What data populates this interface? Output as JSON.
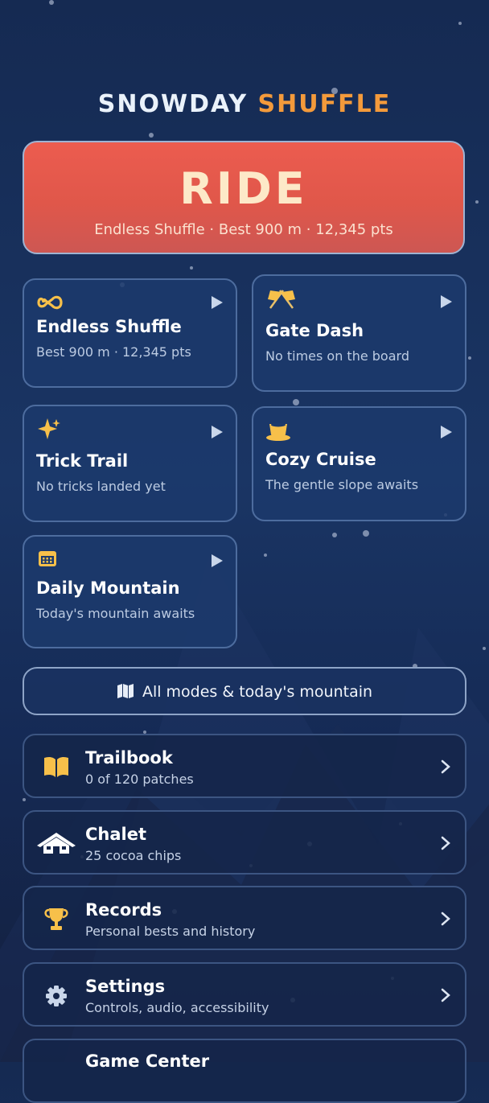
{
  "app": {
    "title_part1": "SNOWDAY",
    "title_part2": "SHUFFLE"
  },
  "ride": {
    "label": "RIDE",
    "subtitle": "Endless Shuffle · Best 900 m · 12,345 pts"
  },
  "modes": [
    {
      "title": "Endless Shuffle",
      "subtitle": "Best 900 m · 12,345 pts",
      "icon": "infinity-icon"
    },
    {
      "title": "Gate Dash",
      "subtitle": "No times on the board",
      "icon": "crossed-flags-icon"
    },
    {
      "title": "Trick Trail",
      "subtitle": "No tricks landed yet",
      "icon": "sparkles-icon"
    },
    {
      "title": "Cozy Cruise",
      "subtitle": "The gentle slope awaits",
      "icon": "cocoa-cup-icon"
    },
    {
      "title": "Daily Mountain",
      "subtitle": "Today's mountain awaits",
      "icon": "calendar-icon"
    }
  ],
  "all_modes": {
    "label": "All modes & today's mountain",
    "icon": "map-icon"
  },
  "menu": [
    {
      "title": "Trailbook",
      "subtitle": "0 of 120 patches",
      "icon": "book-icon"
    },
    {
      "title": "Chalet",
      "subtitle": "25 cocoa chips",
      "icon": "chalet-icon"
    },
    {
      "title": "Records",
      "subtitle": "Personal bests and history",
      "icon": "trophy-icon"
    },
    {
      "title": "Settings",
      "subtitle": "Controls, audio, accessibility",
      "icon": "gear-icon"
    },
    {
      "title": "Game Center",
      "subtitle": "",
      "icon": "game-center-icon"
    }
  ],
  "colors": {
    "accent_orange": "#f39a3b",
    "ride_red": "#e55a4d",
    "icon_gold": "#f7c04a"
  }
}
